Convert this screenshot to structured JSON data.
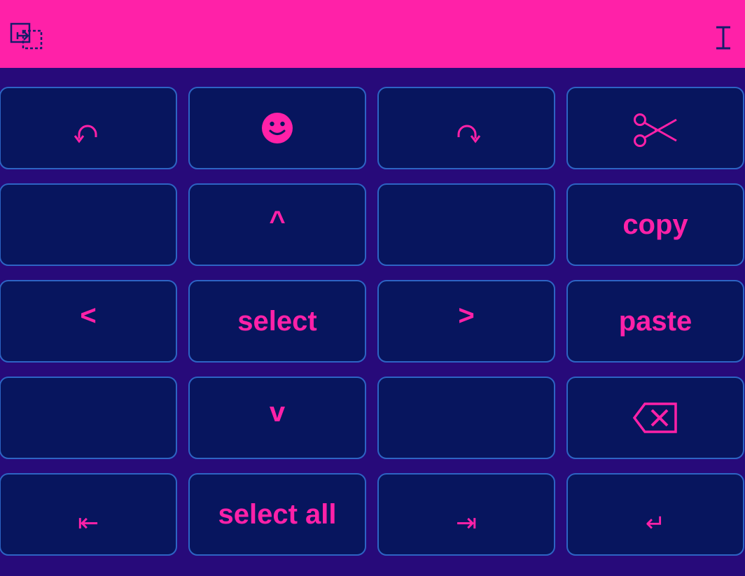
{
  "topbar": {
    "background": "#ff21a8",
    "left_icon": "switch-keyboard-icon",
    "right_icon": "text-cursor-icon"
  },
  "colors": {
    "background": "#270a7a",
    "key_fill": "#07155e",
    "key_border": "#2d64c4",
    "accent": "#ff21a8"
  },
  "keys": {
    "undo": {
      "icon": "undo-icon"
    },
    "emoji": {
      "icon": "emoji-icon"
    },
    "redo": {
      "icon": "redo-icon"
    },
    "cut": {
      "icon": "scissors-icon"
    },
    "up": {
      "label": "^"
    },
    "copy": {
      "label": "copy"
    },
    "left": {
      "label": "<"
    },
    "select": {
      "label": "select"
    },
    "right": {
      "label": ">"
    },
    "paste": {
      "label": "paste"
    },
    "down": {
      "label": "v"
    },
    "backspace": {
      "icon": "backspace-icon"
    },
    "home": {
      "label": "⇤"
    },
    "select_all": {
      "label": "select all"
    },
    "end": {
      "label": "⇥"
    },
    "enter": {
      "label": "↵"
    }
  }
}
